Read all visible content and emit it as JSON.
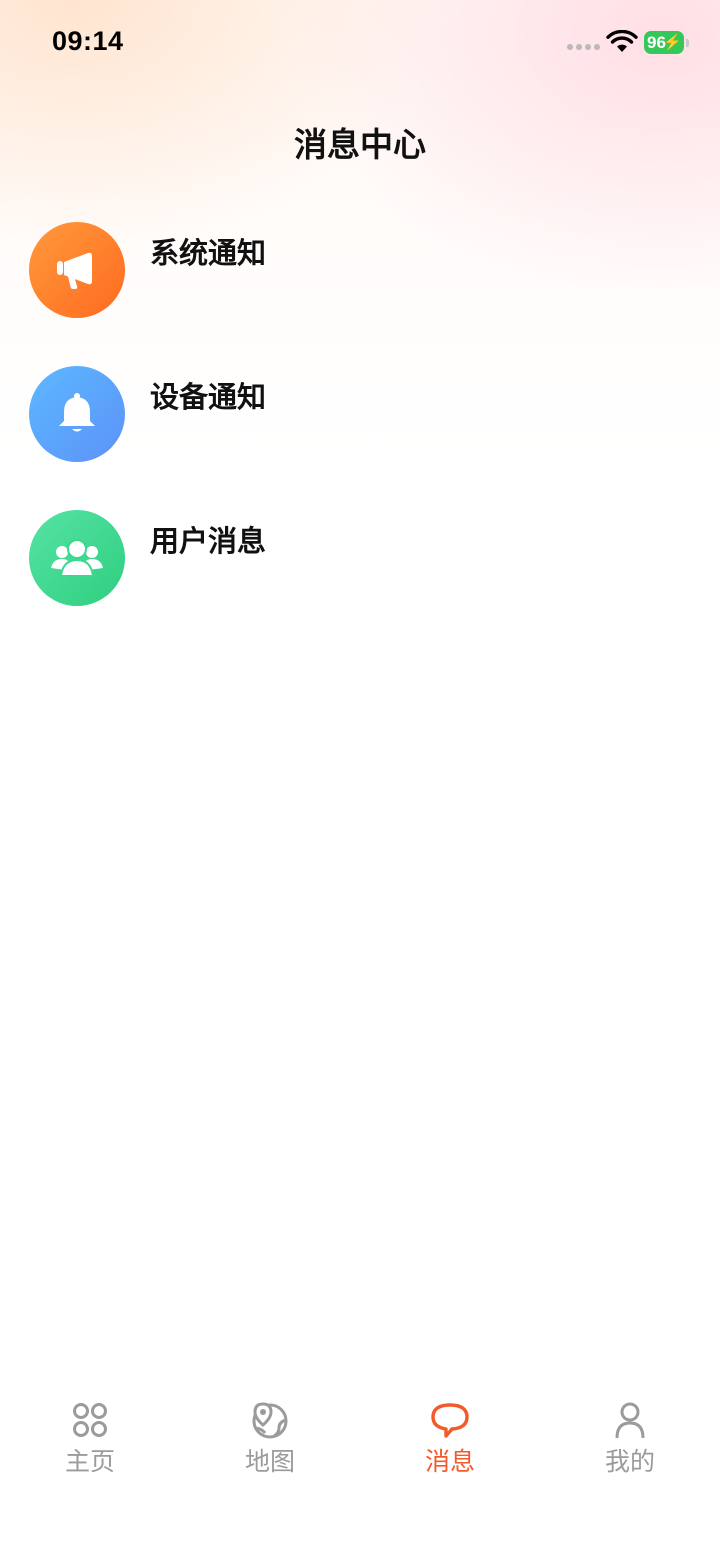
{
  "status_bar": {
    "time": "09:14",
    "battery": "96"
  },
  "header": {
    "title": "消息中心"
  },
  "messages": [
    {
      "title": "系统通知",
      "icon": "megaphone-icon",
      "color": "#ff7a2a"
    },
    {
      "title": "设备通知",
      "icon": "bell-icon",
      "color": "#5aa8fd"
    },
    {
      "title": "用户消息",
      "icon": "users-icon",
      "color": "#3dd88f"
    }
  ],
  "tabs": [
    {
      "label": "主页",
      "icon": "apps-grid-icon",
      "active": false
    },
    {
      "label": "地图",
      "icon": "map-icon",
      "active": false
    },
    {
      "label": "消息",
      "icon": "chat-bubble-icon",
      "active": true
    },
    {
      "label": "我的",
      "icon": "user-icon",
      "active": false
    }
  ],
  "colors": {
    "accent": "#f25a2a",
    "inactive_tab": "#9b9b9b"
  }
}
